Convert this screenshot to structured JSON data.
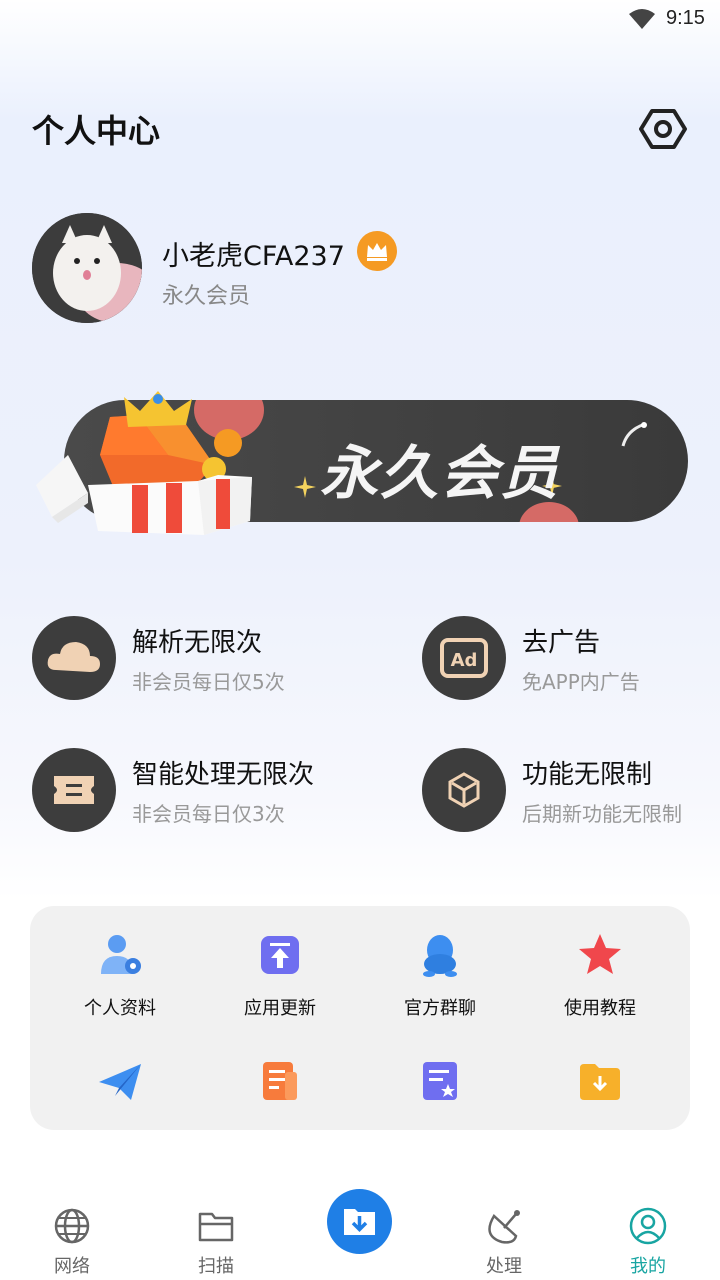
{
  "status_bar": {
    "time": "9:15"
  },
  "header": {
    "title": "个人中心",
    "settings_icon": "gear-icon"
  },
  "profile": {
    "username": "小老虎CFA237",
    "member_status": "永久会员",
    "badge_icon": "crown-icon",
    "badge_color": "#f59a23"
  },
  "banner": {
    "title": "永久会员"
  },
  "features": [
    {
      "title": "解析无限次",
      "subtitle": "非会员每日仅5次",
      "icon": "cloud-icon"
    },
    {
      "title": "去广告",
      "subtitle": "免APP内广告",
      "icon": "ad-icon"
    },
    {
      "title": "智能处理无限次",
      "subtitle": "非会员每日仅3次",
      "icon": "ticket-icon"
    },
    {
      "title": "功能无限制",
      "subtitle": "后期新功能无限制",
      "icon": "cube-icon"
    }
  ],
  "tools": [
    {
      "label": "个人资料",
      "icon": "user-profile-icon"
    },
    {
      "label": "应用更新",
      "icon": "update-icon"
    },
    {
      "label": "官方群聊",
      "icon": "qq-icon"
    },
    {
      "label": "使用教程",
      "icon": "star-icon"
    },
    {
      "label": "",
      "icon": "paper-plane-icon"
    },
    {
      "label": "",
      "icon": "document-list-icon"
    },
    {
      "label": "",
      "icon": "rated-list-icon"
    },
    {
      "label": "",
      "icon": "folder-download-icon"
    }
  ],
  "bottom_nav": {
    "items": [
      {
        "label": "网络",
        "icon": "globe-icon"
      },
      {
        "label": "扫描",
        "icon": "folder-icon"
      },
      {
        "label": "",
        "icon": "download-folder-icon"
      },
      {
        "label": "处理",
        "icon": "satellite-icon"
      },
      {
        "label": "我的",
        "icon": "user-circle-icon"
      }
    ],
    "active_color": "#18a5a2",
    "center_color": "#1f7fe6"
  }
}
